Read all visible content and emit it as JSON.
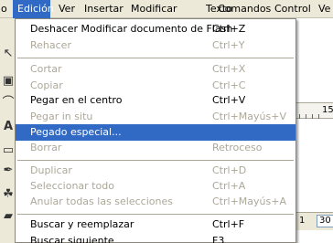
{
  "menubar": {
    "items": [
      "o",
      "Edición",
      "Ver",
      "Insertar",
      "Modificar",
      "Texto",
      "Comandos",
      "Control",
      "Ve"
    ],
    "active_index": 1
  },
  "edit_menu": {
    "items": [
      {
        "label": "Deshacer Modificar documento de Flash",
        "shortcut": "Ctrl+Z",
        "enabled": true
      },
      {
        "label": "Rehacer",
        "shortcut": "Ctrl+Y",
        "enabled": false
      },
      {
        "label": "Cortar",
        "shortcut": "Ctrl+X",
        "enabled": false
      },
      {
        "label": "Copiar",
        "shortcut": "Ctrl+C",
        "enabled": false
      },
      {
        "label": "Pegar en el centro",
        "shortcut": "Ctrl+V",
        "enabled": true
      },
      {
        "label": "Pegar in situ",
        "shortcut": "Ctrl+Mayús+V",
        "enabled": false
      },
      {
        "label": "Pegado especial...",
        "shortcut": "",
        "enabled": true,
        "selected": true
      },
      {
        "label": "Borrar",
        "shortcut": "Retroceso",
        "enabled": false
      },
      {
        "label": "Duplicar",
        "shortcut": "Ctrl+D",
        "enabled": false
      },
      {
        "label": "Seleccionar todo",
        "shortcut": "Ctrl+A",
        "enabled": false
      },
      {
        "label": "Anular todas las selecciones",
        "shortcut": "Ctrl+Mayús+A",
        "enabled": false
      },
      {
        "label": "Buscar y reemplazar",
        "shortcut": "Ctrl+F",
        "enabled": true
      },
      {
        "label": "Buscar siguiente",
        "shortcut": "F3",
        "enabled": true
      }
    ]
  },
  "timeline": {
    "ruler_label": "15",
    "frame_number": "1",
    "fps_value": "30"
  },
  "colors": {
    "highlight": "#316ac5",
    "disabled_text": "#aca899",
    "menubar_bg": "#ece9d8"
  }
}
